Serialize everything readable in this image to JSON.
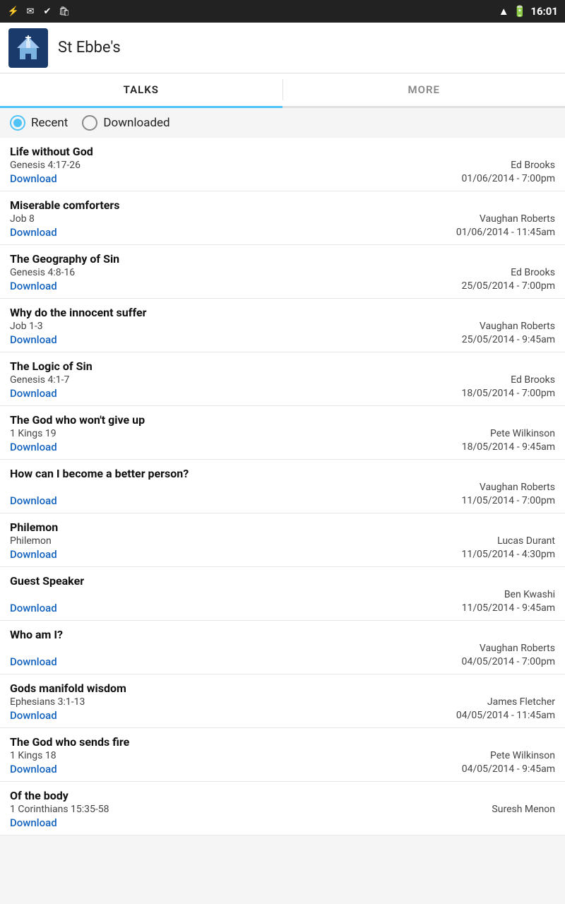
{
  "statusBar": {
    "time": "16:01",
    "icons_left": [
      "usb-icon",
      "gmail-icon",
      "task-icon",
      "shop-icon"
    ],
    "icons_right": [
      "wifi-icon",
      "battery-icon"
    ]
  },
  "appHeader": {
    "title": "St Ebbe's"
  },
  "tabs": [
    {
      "id": "talks",
      "label": "TALKS",
      "active": true
    },
    {
      "id": "more",
      "label": "MORE",
      "active": false
    }
  ],
  "radioOptions": [
    {
      "id": "recent",
      "label": "Recent",
      "selected": true
    },
    {
      "id": "downloaded",
      "label": "Downloaded",
      "selected": false
    }
  ],
  "downloadLabel": "Download",
  "talks": [
    {
      "title": "Life without God",
      "ref": "Genesis 4:17-26",
      "speaker": "Ed Brooks",
      "datetime": "01/06/2014 - 7:00pm"
    },
    {
      "title": "Miserable comforters",
      "ref": "Job 8",
      "speaker": "Vaughan Roberts",
      "datetime": "01/06/2014 - 11:45am"
    },
    {
      "title": "The Geography of Sin",
      "ref": "Genesis 4:8-16",
      "speaker": "Ed Brooks",
      "datetime": "25/05/2014 - 7:00pm"
    },
    {
      "title": "Why do the innocent suffer",
      "ref": "Job 1-3",
      "speaker": "Vaughan Roberts",
      "datetime": "25/05/2014 - 9:45am"
    },
    {
      "title": "The Logic of Sin",
      "ref": "Genesis 4:1-7",
      "speaker": "Ed Brooks",
      "datetime": "18/05/2014 - 7:00pm"
    },
    {
      "title": "The God who won't give up",
      "ref": "1 Kings 19",
      "speaker": "Pete Wilkinson",
      "datetime": "18/05/2014 - 9:45am"
    },
    {
      "title": "How can I become a better person?",
      "ref": "",
      "speaker": "Vaughan Roberts",
      "datetime": "11/05/2014 - 7:00pm"
    },
    {
      "title": "Philemon",
      "ref": "Philemon",
      "speaker": "Lucas Durant",
      "datetime": "11/05/2014 - 4:30pm"
    },
    {
      "title": "Guest Speaker",
      "ref": "",
      "speaker": "Ben Kwashi",
      "datetime": "11/05/2014 - 9:45am"
    },
    {
      "title": "Who am I?",
      "ref": "",
      "speaker": "Vaughan Roberts",
      "datetime": "04/05/2014 - 7:00pm"
    },
    {
      "title": "Gods manifold wisdom",
      "ref": "Ephesians 3:1-13",
      "speaker": "James Fletcher",
      "datetime": "04/05/2014 - 11:45am"
    },
    {
      "title": "The God who sends fire",
      "ref": "1 Kings 18",
      "speaker": "Pete Wilkinson",
      "datetime": "04/05/2014 - 9:45am"
    },
    {
      "title": "Of the body",
      "ref": "1 Corinthians 15:35-58",
      "speaker": "Suresh Menon",
      "datetime": ""
    }
  ]
}
